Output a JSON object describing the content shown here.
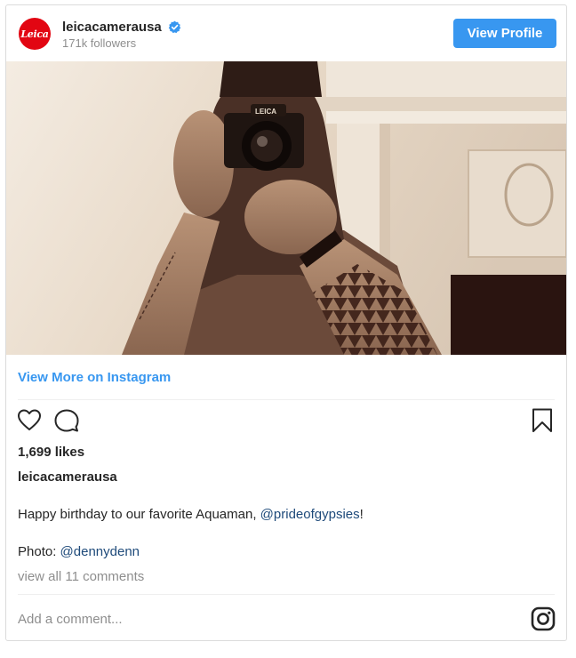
{
  "header": {
    "avatar_text": "Leica",
    "username": "leicacamerausa",
    "followers": "171k followers",
    "view_profile_label": "View Profile"
  },
  "photo": {
    "camera_brand_text": "LEICA"
  },
  "view_more_label": "View More on Instagram",
  "actions": {
    "like_icon": "heart-icon",
    "comment_icon": "comment-icon",
    "save_icon": "bookmark-icon"
  },
  "likes": "1,699 likes",
  "caption": {
    "username": "leicacamerausa",
    "text": "Happy birthday to our favorite Aquaman, ",
    "mention": "@prideofgypsies",
    "text_end": "!",
    "photo_label": "Photo: ",
    "photo_mention": "@dennydenn"
  },
  "comments_link": "view all 11 comments",
  "add_comment_placeholder": "Add a comment...",
  "colors": {
    "brand": "#e20612",
    "accent": "#3897f0",
    "mention": "#1e4a7a"
  }
}
